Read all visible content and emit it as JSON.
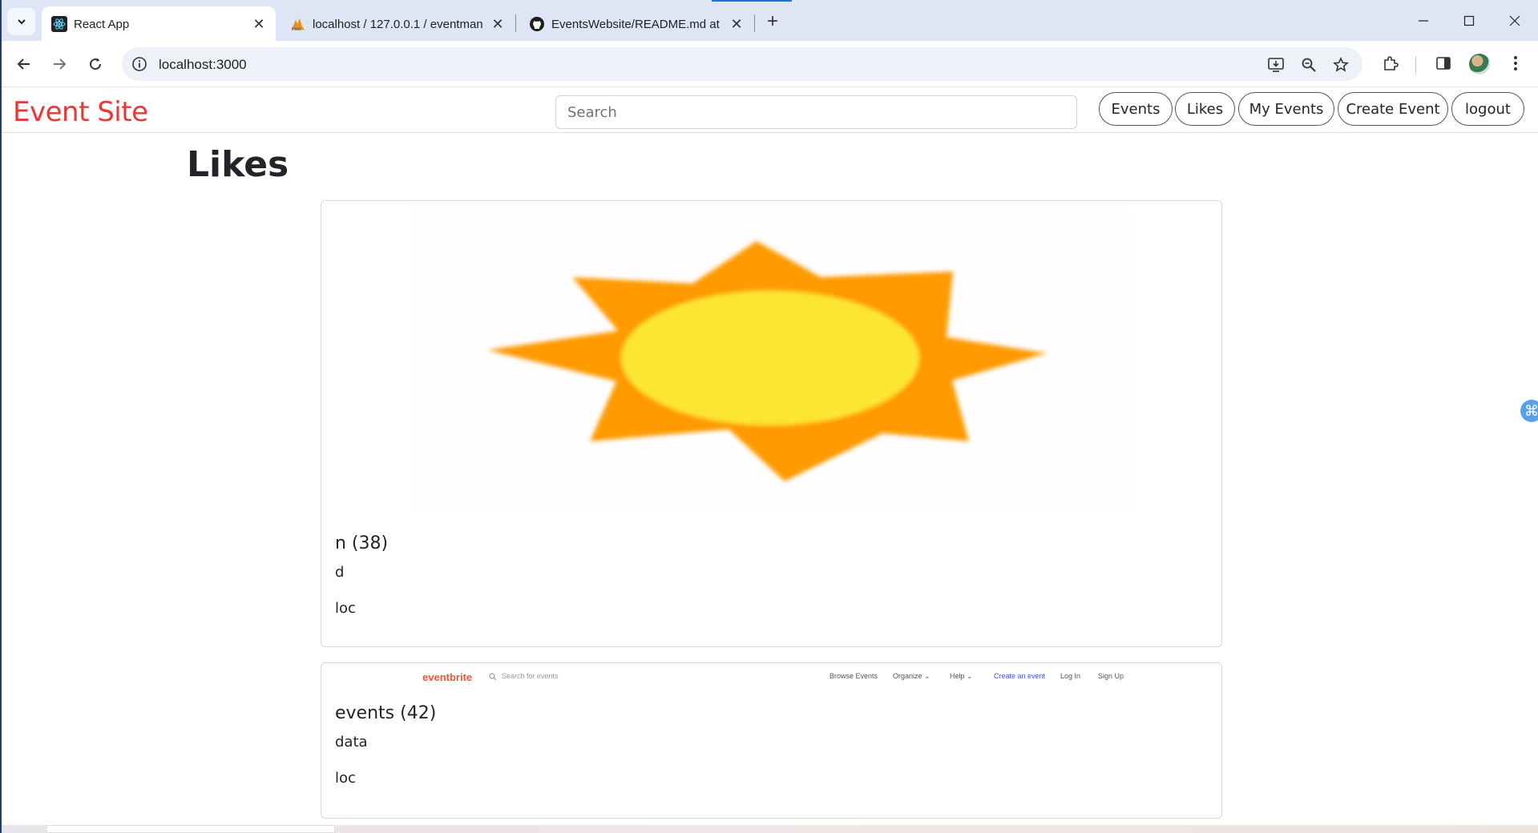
{
  "browser": {
    "tabs": [
      {
        "title": "React App",
        "icon": "react-icon",
        "active": true
      },
      {
        "title": "localhost / 127.0.0.1 / eventman",
        "icon": "phpmyadmin-icon",
        "active": false
      },
      {
        "title": "EventsWebsite/README.md at",
        "icon": "github-icon",
        "active": false
      }
    ],
    "new_tab_label": "+",
    "url": "localhost:3000"
  },
  "navbar": {
    "brand": "Event Site",
    "brand_color": "#e53935",
    "search_placeholder": "Search",
    "buttons": [
      "Events",
      "Likes",
      "My Events",
      "Create Event",
      "logout"
    ]
  },
  "page": {
    "title": "Likes"
  },
  "cards": [
    {
      "title": "n (38)",
      "description": "d",
      "location": "loc",
      "image": "sun-image"
    },
    {
      "title": "events (42)",
      "description": "data",
      "location": "loc",
      "image": "eventbrite-screenshot"
    }
  ],
  "eventbrite_strip": {
    "logo": "eventbrite",
    "search": "Search for events",
    "links": [
      "Browse Events",
      "Organize ⌄",
      "Help ⌄",
      "Create an event",
      "Log In",
      "Sign Up"
    ]
  }
}
